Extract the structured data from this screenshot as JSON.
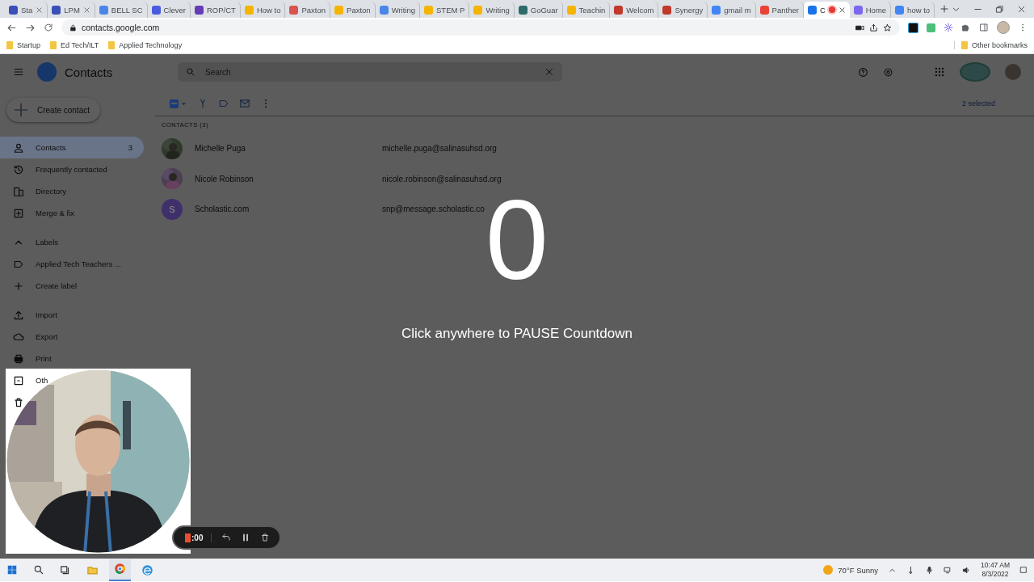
{
  "browser": {
    "tabs": [
      {
        "title": "Sta",
        "color": "#3b4fb8",
        "selected": false,
        "closable": true,
        "recording": false
      },
      {
        "title": "LPM",
        "color": "#3b4fb8",
        "selected": false,
        "closable": true,
        "recording": false
      },
      {
        "title": "BELL SC",
        "color": "#4a86e8",
        "selected": false,
        "closable": false,
        "recording": false
      },
      {
        "title": "Clever",
        "color": "#4a5be0",
        "selected": false,
        "closable": false,
        "recording": false
      },
      {
        "title": "ROP/CT",
        "color": "#673ab7",
        "selected": false,
        "closable": false,
        "recording": false
      },
      {
        "title": "How to",
        "color": "#f4b400",
        "selected": false,
        "closable": false,
        "recording": false
      },
      {
        "title": "Paxton",
        "color": "#d9534f",
        "selected": false,
        "closable": false,
        "recording": false
      },
      {
        "title": "Paxton",
        "color": "#f4b400",
        "selected": false,
        "closable": false,
        "recording": false
      },
      {
        "title": "Writing",
        "color": "#4a86e8",
        "selected": false,
        "closable": false,
        "recording": false
      },
      {
        "title": "STEM P",
        "color": "#f4b400",
        "selected": false,
        "closable": false,
        "recording": false
      },
      {
        "title": "Writing",
        "color": "#f4b400",
        "selected": false,
        "closable": false,
        "recording": false
      },
      {
        "title": "GoGuar",
        "color": "#2e6b6b",
        "selected": false,
        "closable": false,
        "recording": false
      },
      {
        "title": "Teachin",
        "color": "#f4b400",
        "selected": false,
        "closable": false,
        "recording": false
      },
      {
        "title": "Welcom",
        "color": "#c0392b",
        "selected": false,
        "closable": false,
        "recording": false
      },
      {
        "title": "Synergy",
        "color": "#c0392b",
        "selected": false,
        "closable": false,
        "recording": false
      },
      {
        "title": "gmail m",
        "color": "#4285f4",
        "selected": false,
        "closable": false,
        "recording": false
      },
      {
        "title": "Panther",
        "color": "#ea4335",
        "selected": false,
        "closable": false,
        "recording": false
      },
      {
        "title": "C",
        "color": "#1a73e8",
        "selected": true,
        "closable": true,
        "recording": true
      },
      {
        "title": "Home",
        "color": "#7b68ee",
        "selected": false,
        "closable": false,
        "recording": false
      },
      {
        "title": "how to",
        "color": "#4285f4",
        "selected": false,
        "closable": false,
        "recording": false
      }
    ],
    "url": "contacts.google.com",
    "bookmarks": [
      "Startup",
      "Ed Tech/ILT",
      "Applied Technology"
    ],
    "other_bookmarks": "Other bookmarks"
  },
  "app": {
    "title": "Contacts",
    "search": {
      "placeholder": "Search"
    },
    "create_button": "Create contact",
    "nav": [
      {
        "label": "Contacts",
        "count": "3",
        "selected": true
      },
      {
        "label": "Frequently contacted",
        "selected": false
      },
      {
        "label": "Directory",
        "selected": false
      },
      {
        "label": "Merge & fix",
        "selected": false
      }
    ],
    "labels_heading": "Labels",
    "labels": [
      "Applied Tech Teachers ..."
    ],
    "create_label": "Create label",
    "tools": [
      "Import",
      "Export",
      "Print",
      "Oth"
    ],
    "select_all": {
      "mixed": true
    },
    "selection": "2 selected",
    "list_heading": "CONTACTS (3)",
    "contacts": [
      {
        "name": "Michelle Puga",
        "email": "michelle.puga@salinasuhsd.org"
      },
      {
        "name": "Nicole Robinson",
        "email": "nicole.robinson@salinasuhsd.org"
      },
      {
        "kind": "letter",
        "initial": "S",
        "color": "#3f2f6b",
        "name": "Scholastic.com",
        "email": "snp@message.scholastic.co"
      }
    ]
  },
  "countdown": {
    "number": "0",
    "message": "Click anywhere to PAUSE Countdown"
  },
  "recorder": {
    "time": ":00"
  },
  "taskbar": {
    "weather": "70°F Sunny",
    "time": "10:47 AM",
    "date": "8/3/2022"
  }
}
